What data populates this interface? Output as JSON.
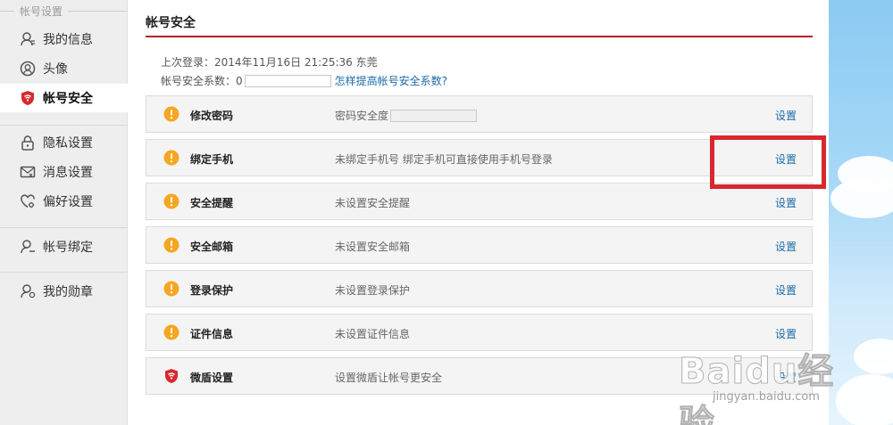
{
  "sidebar": {
    "group_title": "帐号设置",
    "items": [
      {
        "label": "我的信息",
        "icon": "user-icon"
      },
      {
        "label": "头像",
        "icon": "avatar-icon"
      },
      {
        "label": "帐号安全",
        "icon": "weidun-shield-icon",
        "active": true
      },
      {
        "label": "隐私设置",
        "icon": "lock-icon"
      },
      {
        "label": "消息设置",
        "icon": "mail-icon"
      },
      {
        "label": "偏好设置",
        "icon": "heart-gear-icon"
      },
      {
        "label": "帐号绑定",
        "icon": "user-link-icon"
      },
      {
        "label": "我的勋章",
        "icon": "medal-user-icon"
      }
    ]
  },
  "main": {
    "title": "帐号安全",
    "last_login": "上次登录：2014年11月16日  21:25:36  东莞",
    "security_score_label": "帐号安全系数：0",
    "security_score_value": 0,
    "improve_link": "怎样提高帐号安全系数?",
    "rows": [
      {
        "name": "修改密码",
        "desc": "密码安全度",
        "action": "设置",
        "icon": "warning-icon",
        "has_bar": true
      },
      {
        "name": "绑定手机",
        "desc": "未绑定手机号 绑定手机可直接使用手机号登录",
        "action": "设置",
        "icon": "warning-icon"
      },
      {
        "name": "安全提醒",
        "desc": "未设置安全提醒",
        "action": "设置",
        "icon": "warning-icon"
      },
      {
        "name": "安全邮箱",
        "desc": "未设置安全邮箱",
        "action": "设置",
        "icon": "warning-icon"
      },
      {
        "name": "登录保护",
        "desc": "未设置登录保护",
        "action": "设置",
        "icon": "warning-icon"
      },
      {
        "name": "证件信息",
        "desc": "未设置证件信息",
        "action": "设置",
        "icon": "warning-icon"
      },
      {
        "name": "微盾设置",
        "desc": "设置微盾让帐号更安全",
        "action": "设置",
        "icon": "weidun-shield-icon"
      }
    ]
  },
  "watermark": {
    "logo": "Baidu经验",
    "url": "jingyan.baidu.com"
  },
  "colors": {
    "accent_red": "#b3222b",
    "link_blue": "#1a6aa8",
    "warning_orange": "#f5a623",
    "highlight_red": "#d8282e"
  }
}
